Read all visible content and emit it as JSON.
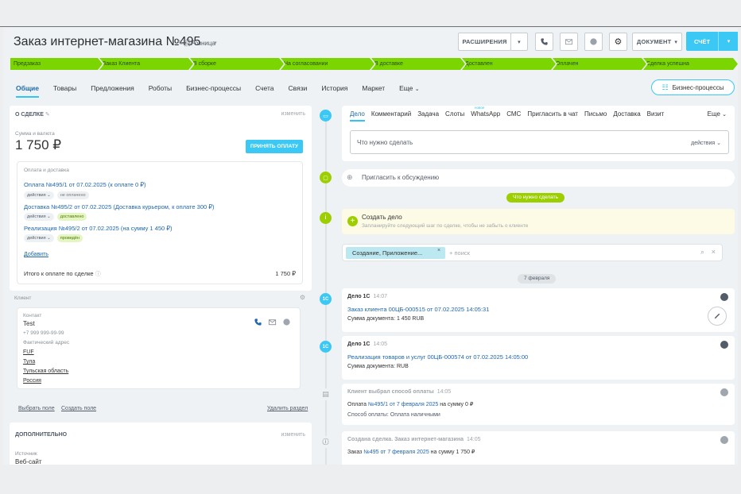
{
  "header": {
    "title": "Заказ интернет-магазина №495",
    "sub": "Розница",
    "btn_extensions": "РАСШИРЕНИЯ",
    "btn_document": "ДОКУМЕНТ",
    "btn_invoice": "СЧЁТ"
  },
  "stages": [
    "Предзаказ",
    "Заказ Клиента",
    "В сборке",
    "На согласовании",
    "В доставке",
    "Доставлен",
    "Оплачен",
    "Сделка успешна"
  ],
  "tabs": [
    "Общие",
    "Товары",
    "Предложения",
    "Роботы",
    "Бизнес-процессы",
    "Счета",
    "Связи",
    "История",
    "Маркет",
    "Еще"
  ],
  "bp_button": "Бизнес-процессы",
  "deal": {
    "head": "О СДЕЛКЕ",
    "edit": "изменить",
    "sum_label": "Сумма и валюта",
    "sum": "1 750 ₽",
    "pay_button": "ПРИНЯТЬ ОПЛАТУ",
    "pay_section": "Оплата и доставка",
    "docs": [
      {
        "text": "Оплата №495/1 от 07.02.2025 (к оплате 0 ₽)",
        "action": "действия",
        "status": "не оплачено"
      },
      {
        "text": "Доставка №495/2 от 07.02.2025 (Доставка курьером, к оплате 300 ₽)",
        "action": "действия",
        "status": "доставлено"
      },
      {
        "text": "Реализация №495/2 от 07.02.2025 (на сумму 1 450 ₽)",
        "action": "действия",
        "status": "проведён"
      }
    ],
    "add": "Добавить",
    "total_label": "Итого к оплате по сделке",
    "total_value": "1 750 ₽"
  },
  "client": {
    "head": "Клиент",
    "contact_label": "Контакт",
    "name": "Test",
    "phone": "+7 999 999-99-99",
    "address_label": "Фактический адрес",
    "address": [
      "FUF",
      "Тула",
      "Тульская область",
      "Россия"
    ],
    "choose_field": "Выбрать поле",
    "create_field": "Создать поле",
    "delete_section": "Удалить раздел"
  },
  "extra": {
    "head": "ДОПОЛНИТЕЛЬНО",
    "edit": "изменить",
    "source_label": "Источник",
    "source_value": "Веб-сайт"
  },
  "timeline": {
    "tabs": [
      "Дело",
      "Комментарий",
      "Задача",
      "Слоты",
      "WhatsApp",
      "СМС",
      "Пригласить в чат",
      "Письмо",
      "Доставка",
      "Визит"
    ],
    "new_badge": "новое",
    "more": "Еще",
    "todo_placeholder": "Что нужно сделать",
    "todo_actions": "действия",
    "invite": "Пригласить к обсуждению",
    "todo_pill": "Что нужно сделать",
    "create_title": "Создать дело",
    "create_hint": "Запланируйте следующий шаг по сделке, чтобы не забыть о клиенте",
    "filter_tag": "Создание, Приложение...",
    "filter_placeholder": "+ поиск",
    "date_pill": "7 февраля",
    "events": [
      {
        "title": "Дело 1С",
        "time": "14:07",
        "link": "Заказ клиента 00ЦБ-000515 от 07.02.2025 14:05:31",
        "line": "Сумма документа: 1 450 RUB"
      },
      {
        "title": "Дело 1С",
        "time": "14:05",
        "link": "Реализация товаров и услуг 00ЦБ-000574 от 07.02.2025 14:05:00",
        "line": "Сумма документа: RUB"
      },
      {
        "title": "Клиент выбрал способ оплаты",
        "time": "14:05",
        "line_pre": "Оплата ",
        "line_link": "№495/1 от 7 февраля 2025",
        "line_post": " на сумму 0 ₽",
        "line2": "Способ оплаты: Оплата наличными"
      },
      {
        "title": "Создана сделка. Заказ интернет-магазина",
        "time": "14:05",
        "line_pre": "Заказ ",
        "line_link": "№495 от 7 февраля 2025",
        "line_post": " на сумму 1 750 ₽"
      }
    ]
  }
}
